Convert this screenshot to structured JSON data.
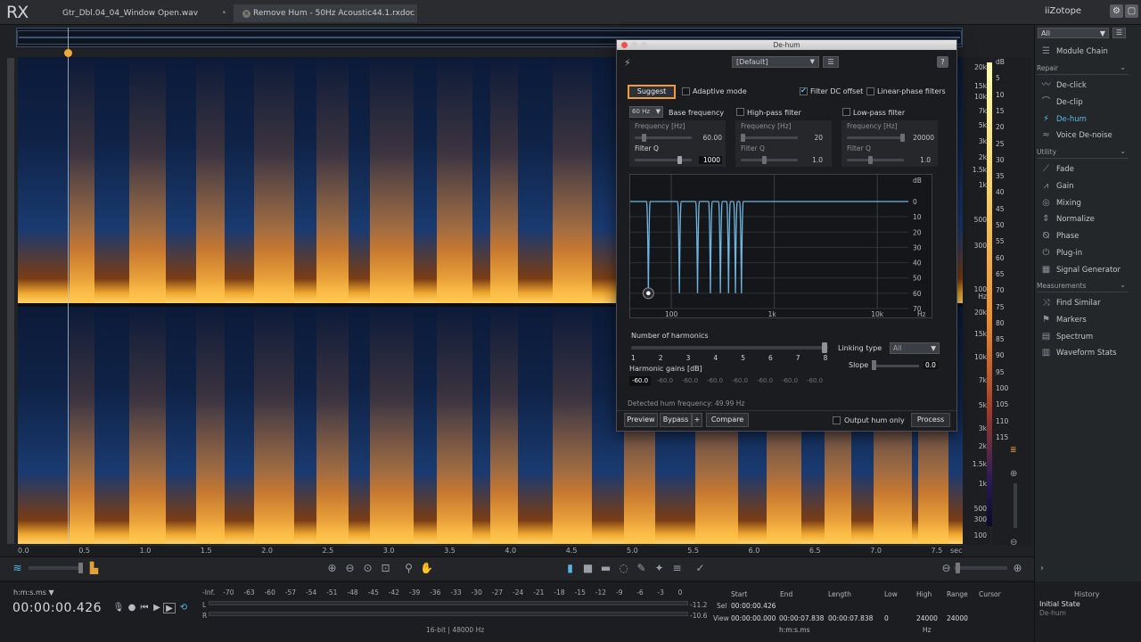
{
  "app": {
    "logo": "RX",
    "brand": "iZotope"
  },
  "tabs": [
    {
      "label": "Gtr_Dbl.04_04_Window Open.wav",
      "close": "•"
    },
    {
      "label": "Remove Hum - 50Hz Acoustic44.1.rxdoc",
      "close": "•"
    }
  ],
  "time_axis": {
    "ticks": [
      "0.0",
      "0.5",
      "1.0",
      "1.5",
      "2.0",
      "2.5",
      "3.0",
      "3.5",
      "4.0",
      "4.5",
      "5.0",
      "5.5",
      "6.0",
      "6.5",
      "7.0",
      "7.5"
    ],
    "unit": "sec"
  },
  "hz_axis": {
    "top": [
      "20k",
      "15k",
      "10k",
      "7k",
      "5k",
      "3k",
      "2k",
      "1.5k",
      "1k",
      "500",
      "300",
      "100"
    ],
    "bottom": [
      "20k",
      "15k",
      "10k",
      "7k",
      "5k",
      "3k",
      "2k",
      "1.5k",
      "1k",
      "500",
      "300",
      "100"
    ],
    "unit": "Hz"
  },
  "db_axis": [
    "dB",
    "5",
    "10",
    "15",
    "20",
    "25",
    "30",
    "35",
    "40",
    "45",
    "50",
    "55",
    "60",
    "65",
    "70",
    "75",
    "80",
    "85",
    "90",
    "95",
    "100",
    "105",
    "110",
    "115"
  ],
  "dialog": {
    "title": "De-hum",
    "preset": "[Default]",
    "help": "?",
    "suggest": "Suggest",
    "adaptive_mode": "Adaptive mode",
    "filter_dc": "Filter DC offset",
    "linear_phase": "Linear-phase filters",
    "base_freq_value": "60 Hz",
    "base_freq_label": "Base frequency",
    "hp_label": "High-pass filter",
    "lp_label": "Low-pass filter",
    "freq_label": "Frequency [Hz]",
    "q_label": "Filter Q",
    "base": {
      "freq": "60.00",
      "q": "1000"
    },
    "hp": {
      "freq": "20",
      "q": "1.0"
    },
    "lp": {
      "freq": "20000",
      "q": "1.0"
    },
    "graph": {
      "db_ticks": [
        "dB",
        "0",
        "10",
        "20",
        "30",
        "40",
        "50",
        "60",
        "70"
      ],
      "x_ticks": [
        "100",
        "1k",
        "10k",
        "Hz"
      ]
    },
    "num_harmonics_label": "Number of harmonics",
    "harmonics": [
      "1",
      "2",
      "3",
      "4",
      "5",
      "6",
      "7",
      "8"
    ],
    "harmonic_gains_label": "Harmonic gains [dB]",
    "harmonic_gains": [
      "-60.0",
      "-60.0",
      "-60.0",
      "-60.0",
      "-60.0",
      "-60.0",
      "-60.0",
      "-60.0"
    ],
    "linking_label": "Linking type",
    "linking_value": "All",
    "slope_label": "Slope",
    "slope_value": "0.0",
    "detected": "Detected hum frequency: 49.99 Hz",
    "preview": "Preview",
    "bypass": "Bypass",
    "plus": "+",
    "compare": "Compare",
    "output_hum": "Output hum only",
    "process": "Process"
  },
  "right_panel": {
    "filter": "All",
    "module_chain": "Module Chain",
    "repair_cat": "Repair",
    "repair": [
      "De-click",
      "De-clip",
      "De-hum",
      "Voice De-noise"
    ],
    "utility_cat": "Utility",
    "utility": [
      "Fade",
      "Gain",
      "Mixing",
      "Normalize",
      "Phase",
      "Plug-in",
      "Signal Generator"
    ],
    "measure_cat": "Measurements",
    "measure": [
      "Find Similar",
      "Markers",
      "Spectrum",
      "Waveform Stats"
    ]
  },
  "status": {
    "time_format": "h:m:s.ms ▼",
    "timecode": "00:00:00.426",
    "meter_ticks": [
      "-Inf.",
      "-70",
      "-63",
      "-60",
      "-57",
      "-54",
      "-51",
      "-48",
      "-45",
      "-42",
      "-39",
      "-36",
      "-33",
      "-30",
      "-27",
      "-24",
      "-21",
      "-18",
      "-15",
      "-12",
      "-9",
      "-6",
      "-3",
      "0"
    ],
    "meter_L": "L",
    "meter_R": "R",
    "meter_L_val": "-11.2",
    "meter_R_val": "-10.6",
    "bit_info": "16-bit | 48000 Hz",
    "sel": {
      "h_start": "Start",
      "h_end": "End",
      "h_length": "Length",
      "h_low": "Low",
      "h_high": "High",
      "h_range": "Range",
      "h_cursor": "Cursor",
      "sel_label": "Sel",
      "view_label": "View",
      "sel_start": "00:00:00.426",
      "view_start": "00:00:00.000",
      "view_end": "00:00:07.838",
      "view_length": "00:00:07.838",
      "low": "0",
      "high": "24000",
      "range": "24000",
      "unit_time": "h:m:s.ms",
      "unit_hz": "Hz"
    }
  },
  "history": {
    "title": "History",
    "items": [
      "Initial State",
      "De-hum"
    ]
  },
  "colors": {
    "accent": "#58b7e6",
    "suggest_border": "#f39a3c",
    "playhead_marker": "#f2a93b"
  }
}
